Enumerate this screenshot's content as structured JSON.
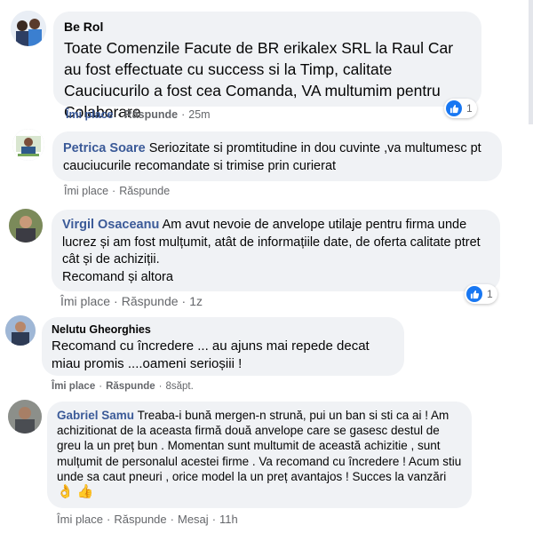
{
  "comments": [
    {
      "author": "Be Rol",
      "text": "Toate Comenzile Facute de BR erikalex SRL la Raul Car au fost effectuate cu success si la Timp, calitate Cauciucurilo a fost cea Comanda, VA multumim pentru Colaborare",
      "like": "Îmi place",
      "reply": "Răspunde",
      "time": "25m",
      "reaction_count": "1"
    },
    {
      "author": "Petrica Soare",
      "text": "Seriozitate si promtitudine in dou cuvinte ,va multumesc pt cauciucurile recomandate si trimise prin curierat",
      "like": "Îmi place",
      "reply": "Răspunde"
    },
    {
      "author": "Virgil Osaceanu",
      "text": "Am avut nevoie de anvelope utilaje pentru firma unde lucrez și am fost mulțumit, atât de informațiile date, de oferta calitate ptret cât și de achiziții.",
      "text2": "Recomand și altora",
      "like": "Îmi place",
      "reply": "Răspunde",
      "time": "1z",
      "reaction_count": "1"
    },
    {
      "author": "Nelutu Gheorghies",
      "text": "Recomand cu încredere ... au ajuns mai repede decat miau promis ....oameni serioșiii !",
      "like": "Îmi place",
      "reply": "Răspunde",
      "time": "8săpt."
    },
    {
      "author": "Gabriel Samu",
      "text": "Treaba-i bună mergen-n strună, pui un ban si sti ca ai ! Am achizitionat de la aceasta firmă două anvelope care se gasesc destul de greu la un preț bun . Momentan sunt multumit de această achizitie , sunt mulțumit de personalul acestei firme . Va recomand cu încredere ! Acum stiu unde sa caut pneuri , orice model la un preț avantajos ! Succes la vanzări",
      "emoji": "👌 👍",
      "like": "Îmi place",
      "reply": "Răspunde",
      "message": "Mesaj",
      "time": "11h"
    }
  ],
  "colors": {
    "bubble": "#f0f2f5",
    "author_blue": "#3b5a98",
    "meta_gray": "#65676b",
    "like_blue": "#1877f2"
  },
  "icons": [
    "avatar",
    "like-icon"
  ]
}
